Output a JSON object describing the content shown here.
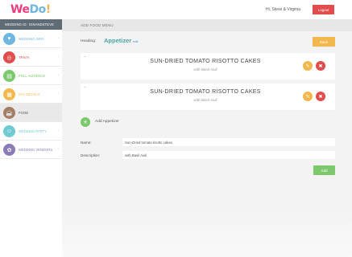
{
  "header": {
    "logo_we": "We",
    "logo_do": "Do",
    "logo_bang": "!",
    "greeting": "Hi, Steve & Virginia",
    "logout_label": "Logout"
  },
  "sidebar": {
    "header_prefix": "WEDDING ID:",
    "header_id": "GINANDSTEVE",
    "items": [
      {
        "label": "WEDDING INFO",
        "icon": "heart-icon",
        "color": "#6fb7e0",
        "glyph": "♥"
      },
      {
        "label": "TRIVIA",
        "icon": "trivia-icon",
        "color": "#e14c4c",
        "glyph": "◎"
      },
      {
        "label": "POLL AUDIENCE",
        "icon": "poll-icon",
        "color": "#7bc96c",
        "glyph": "▤"
      },
      {
        "label": "DAY DETAILS",
        "icon": "calendar-icon",
        "color": "#f3b84d",
        "glyph": "▦"
      },
      {
        "label": "FOOD",
        "icon": "food-icon",
        "color": "#a67c63",
        "glyph": "☕"
      },
      {
        "label": "WEDDING PARTY",
        "icon": "party-icon",
        "color": "#6fcbd1",
        "glyph": "☺"
      },
      {
        "label": "WEDDING VENDORS",
        "icon": "vendors-icon",
        "color": "#8c7bb8",
        "glyph": "✿"
      }
    ]
  },
  "main": {
    "title": "ADD FOOD MENU",
    "heading_label": "Heading:",
    "heading_value": "Appetizer",
    "edit_label": "edit",
    "save_label": "Save",
    "items": [
      {
        "name": "SUN-DRIED TOMATO RISOTTO CAKES",
        "description": "with Basil Aioli"
      },
      {
        "name": "SUN-DRIED TOMATO RISOTTO CAKES",
        "description": "with Basil Aioli"
      }
    ],
    "add_appetizer_label": "Add Appetizer",
    "form": {
      "name_label": "Name:",
      "name_value": "Sun-Dried tomato risotto cakes",
      "description_label": "Description:",
      "description_value": "with Basil Aioli"
    },
    "add_label": "Add"
  },
  "colors": {
    "accent_red": "#e14c4c",
    "accent_yellow": "#f3b84d",
    "accent_green": "#7bc96c",
    "heading_teal": "#4aa8a4"
  }
}
